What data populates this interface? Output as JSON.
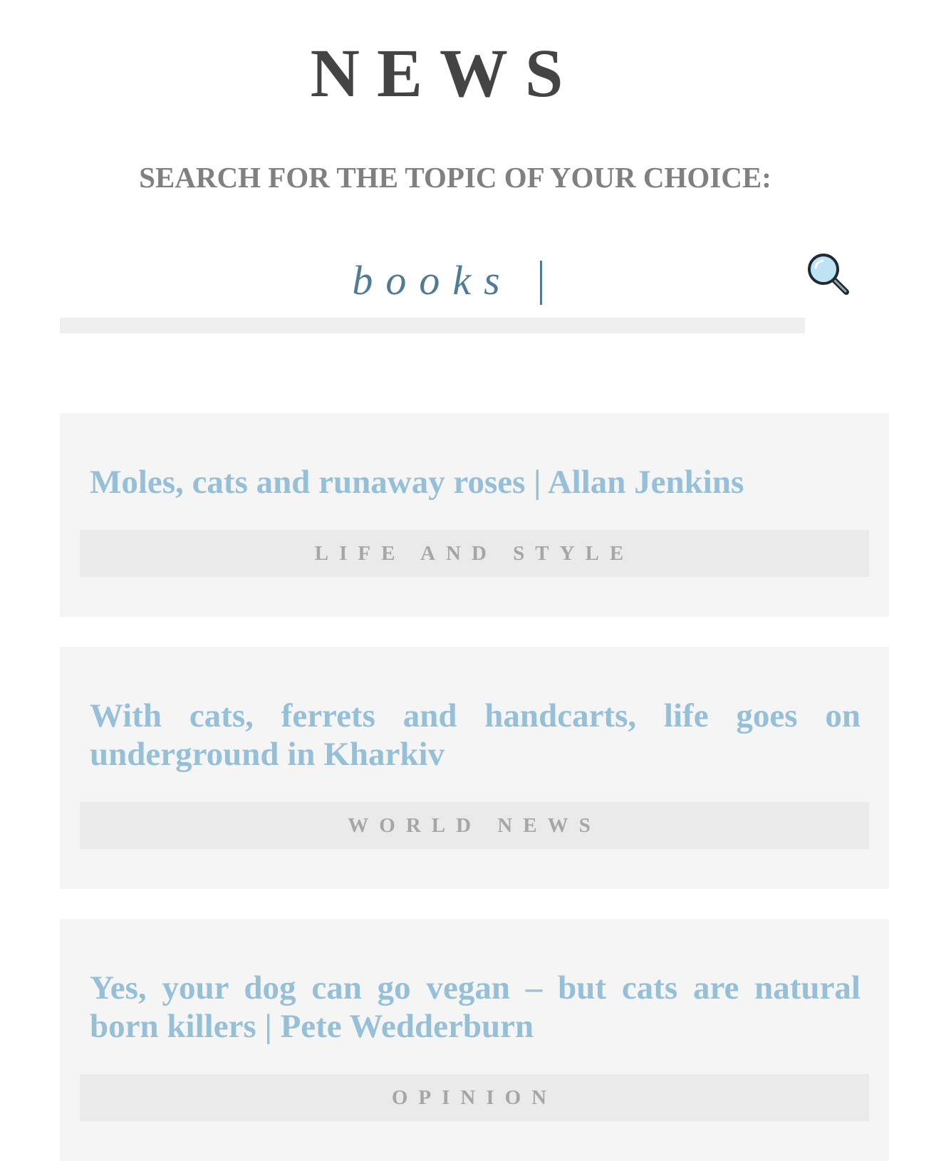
{
  "header": {
    "title": "NEWS",
    "prompt": "SEARCH FOR THE TOPIC OF YOUR CHOICE:"
  },
  "search": {
    "value": "books",
    "icon": "magnifying-glass-icon"
  },
  "articles": [
    {
      "headline": "Moles, cats and runaway roses | Allan Jenkins",
      "section": "LIFE AND STYLE"
    },
    {
      "headline": "With cats, ferrets and handcarts, life goes on underground in Kharkiv",
      "section": "WORLD NEWS"
    },
    {
      "headline": "Yes, your dog can go vegan – but cats are natural born killers | Pete Wedderburn",
      "section": "OPINION"
    }
  ],
  "colors": {
    "title": "#444444",
    "prompt": "#808080",
    "search_text": "#4e7b96",
    "headline": "#96bfd8",
    "card_background": "#f5f5f5",
    "tag_background": "#ebeaeb",
    "tag_text": "#a6a6a6"
  }
}
